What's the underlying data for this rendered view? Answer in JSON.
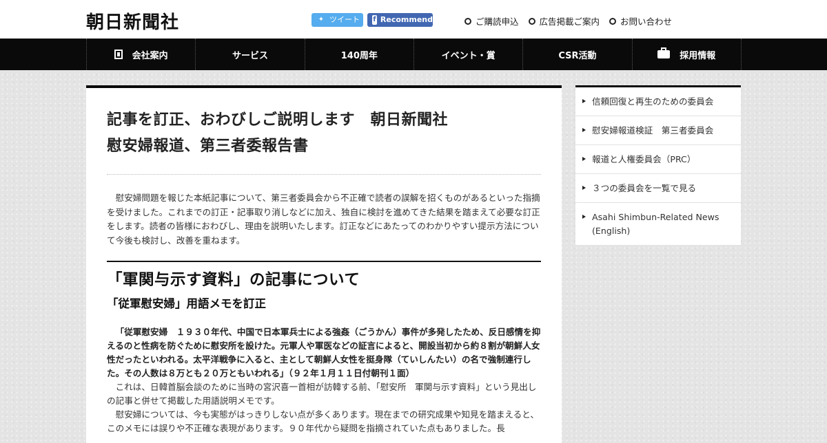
{
  "header": {
    "logo": "朝日新聞社",
    "share": {
      "tweet": "ツイート",
      "recommend": "Recommend"
    },
    "links": [
      "ご購読申込",
      "広告掲載ご案内",
      "お問い合わせ"
    ]
  },
  "nav": {
    "items": [
      "会社案内",
      "サービス",
      "140周年",
      "イベント・賞",
      "CSR活動",
      "採用情報"
    ]
  },
  "article": {
    "title_line1": "記事を訂正、おわびしご説明します　朝日新聞社",
    "title_line2": "慰安婦報道、第三者委報告書",
    "lead": "慰安婦問題を報じた本紙記事について、第三者委員会から不正確で読者の誤解を招くものがあるといった指摘を受けました。これまでの訂正・記事取り消しなどに加え、独自に検討を進めてきた結果を踏まえて必要な訂正をします。読者の皆様におわびし、理由を説明いたします。訂正などにあたってのわかりやすい提示方法について今後も検討し、改善を重ねます。",
    "section_heading": "「軍関与示す資料」の記事について",
    "section_subheading": "「従軍慰安婦」用語メモを訂正",
    "quote": "「従軍慰安婦　１９３０年代、中国で日本軍兵士による強姦（ごうかん）事件が多発したため、反日感情を抑えるのと性病を防ぐために慰安所を設けた。元軍人や軍医などの証言によると、開設当初から約８割が朝鮮人女性だったといわれる。太平洋戦争に入ると、主として朝鮮人女性を挺身隊（ていしんたい）の名で強制連行した。その人数は８万とも２０万ともいわれる」（９２年１月１１日付朝刊１面）",
    "para1": "これは、日韓首脳会談のために当時の宮沢喜一首相が訪韓する前、「慰安所　軍関与示す資料」という見出しの記事と併せて掲載した用語説明メモです。",
    "para2": "慰安婦については、今も実態がはっきりしない点が多くあります。現在までの研究成果や知見を踏まえると、このメモには誤りや不正確な表現があります。９０年代から疑問を指摘されていた点もありました。長"
  },
  "sidebar": {
    "items": [
      "信頼回復と再生のための委員会",
      "慰安婦報道検証　第三者委員会",
      "報道と人権委員会（PRC）",
      "３つの委員会を一覧で見る",
      "Asahi Shimbun-Related News (English)"
    ]
  }
}
